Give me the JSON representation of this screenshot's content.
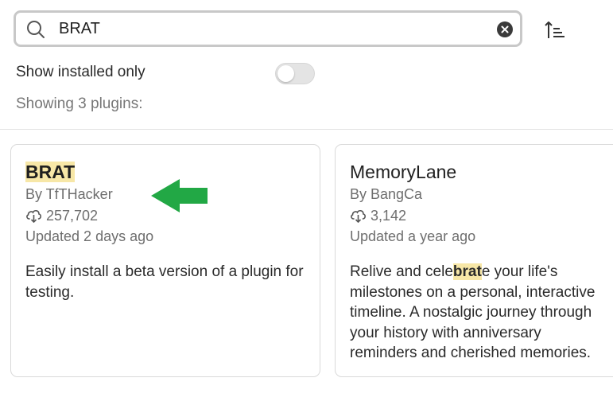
{
  "search": {
    "value": "BRAT",
    "clear_icon": "clear-circle-x-icon",
    "search_icon": "magnifier-icon",
    "sort_icon": "sort-ascending-icon"
  },
  "filters": {
    "show_installed_label": "Show installed only",
    "show_installed_enabled": false
  },
  "results": {
    "count_text": "Showing 3 plugins:"
  },
  "plugins": [
    {
      "title_highlight": "BRAT",
      "title_rest": "",
      "author": "By TfTHacker",
      "downloads": "257,702",
      "updated": "Updated 2 days ago",
      "description": "Easily install a beta version of a plugin for testing."
    },
    {
      "title_plain": "MemoryLane",
      "author": "By BangCa",
      "downloads": "3,142",
      "updated": "Updated a year ago",
      "desc_line1_pre": "Relive and cele",
      "desc_line1_hl": "brat",
      "desc_line1_post": "e your life's",
      "desc_line2": "milestones on a personal, interactive",
      "desc_line3": "timeline. A nostalgic journey through",
      "desc_line4": "your history with anniversary",
      "desc_line5": "reminders and cherished memories."
    }
  ],
  "colors": {
    "highlight": "#f7e7a7",
    "annotation_arrow": "#22a845",
    "muted_text": "#6e6e6e"
  },
  "annotation": {
    "arrow_icon": "green-arrow-left-icon"
  }
}
